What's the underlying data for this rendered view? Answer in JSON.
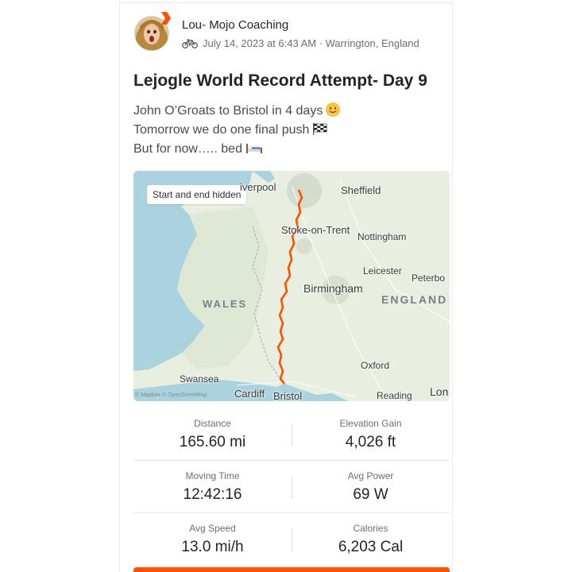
{
  "post": {
    "author": "Lou- Mojo Coaching",
    "activity_icon": "bike-icon",
    "meta": "July 14, 2023 at 6:43 AM · Warrington, England",
    "title": "Lejogle World Record Attempt- Day 9",
    "description": [
      "John O’Groats to Bristol in 4 days",
      "Tomorrow we do one final push",
      "But for now….. bed"
    ],
    "emojis": [
      "smiling-face-icon",
      "checkered-flag-icon",
      "bed-icon"
    ]
  },
  "map": {
    "badge": "Start and end hidden",
    "attribution": "© Mapbox © OpenStreetMap",
    "places": {
      "liverpool": "iverpool",
      "sheffield": "Sheffield",
      "stoke": "Stoke-on-Trent",
      "nottingham": "Nottingham",
      "leicester": "Leicester",
      "peterborough": "Peterbo",
      "birmingham": "Birmingham",
      "wales": "WALES",
      "england": "ENGLAND",
      "oxford": "Oxford",
      "swansea": "Swansea",
      "cardiff": "Cardiff",
      "bristol": "Bristol",
      "reading": "Reading",
      "london": "Lon"
    },
    "route_color": "#fc5200"
  },
  "stats": [
    {
      "label": "Distance",
      "value": "165.60 mi"
    },
    {
      "label": "Elevation Gain",
      "value": "4,026 ft"
    },
    {
      "label": "Moving Time",
      "value": "12:42:16"
    },
    {
      "label": "Avg Power",
      "value": "69 W"
    },
    {
      "label": "Avg Speed",
      "value": "13.0 mi/h"
    },
    {
      "label": "Calories",
      "value": "6,203 Cal"
    }
  ],
  "colors": {
    "accent": "#fc5200",
    "text": "#242428",
    "muted": "#6d6d78"
  }
}
